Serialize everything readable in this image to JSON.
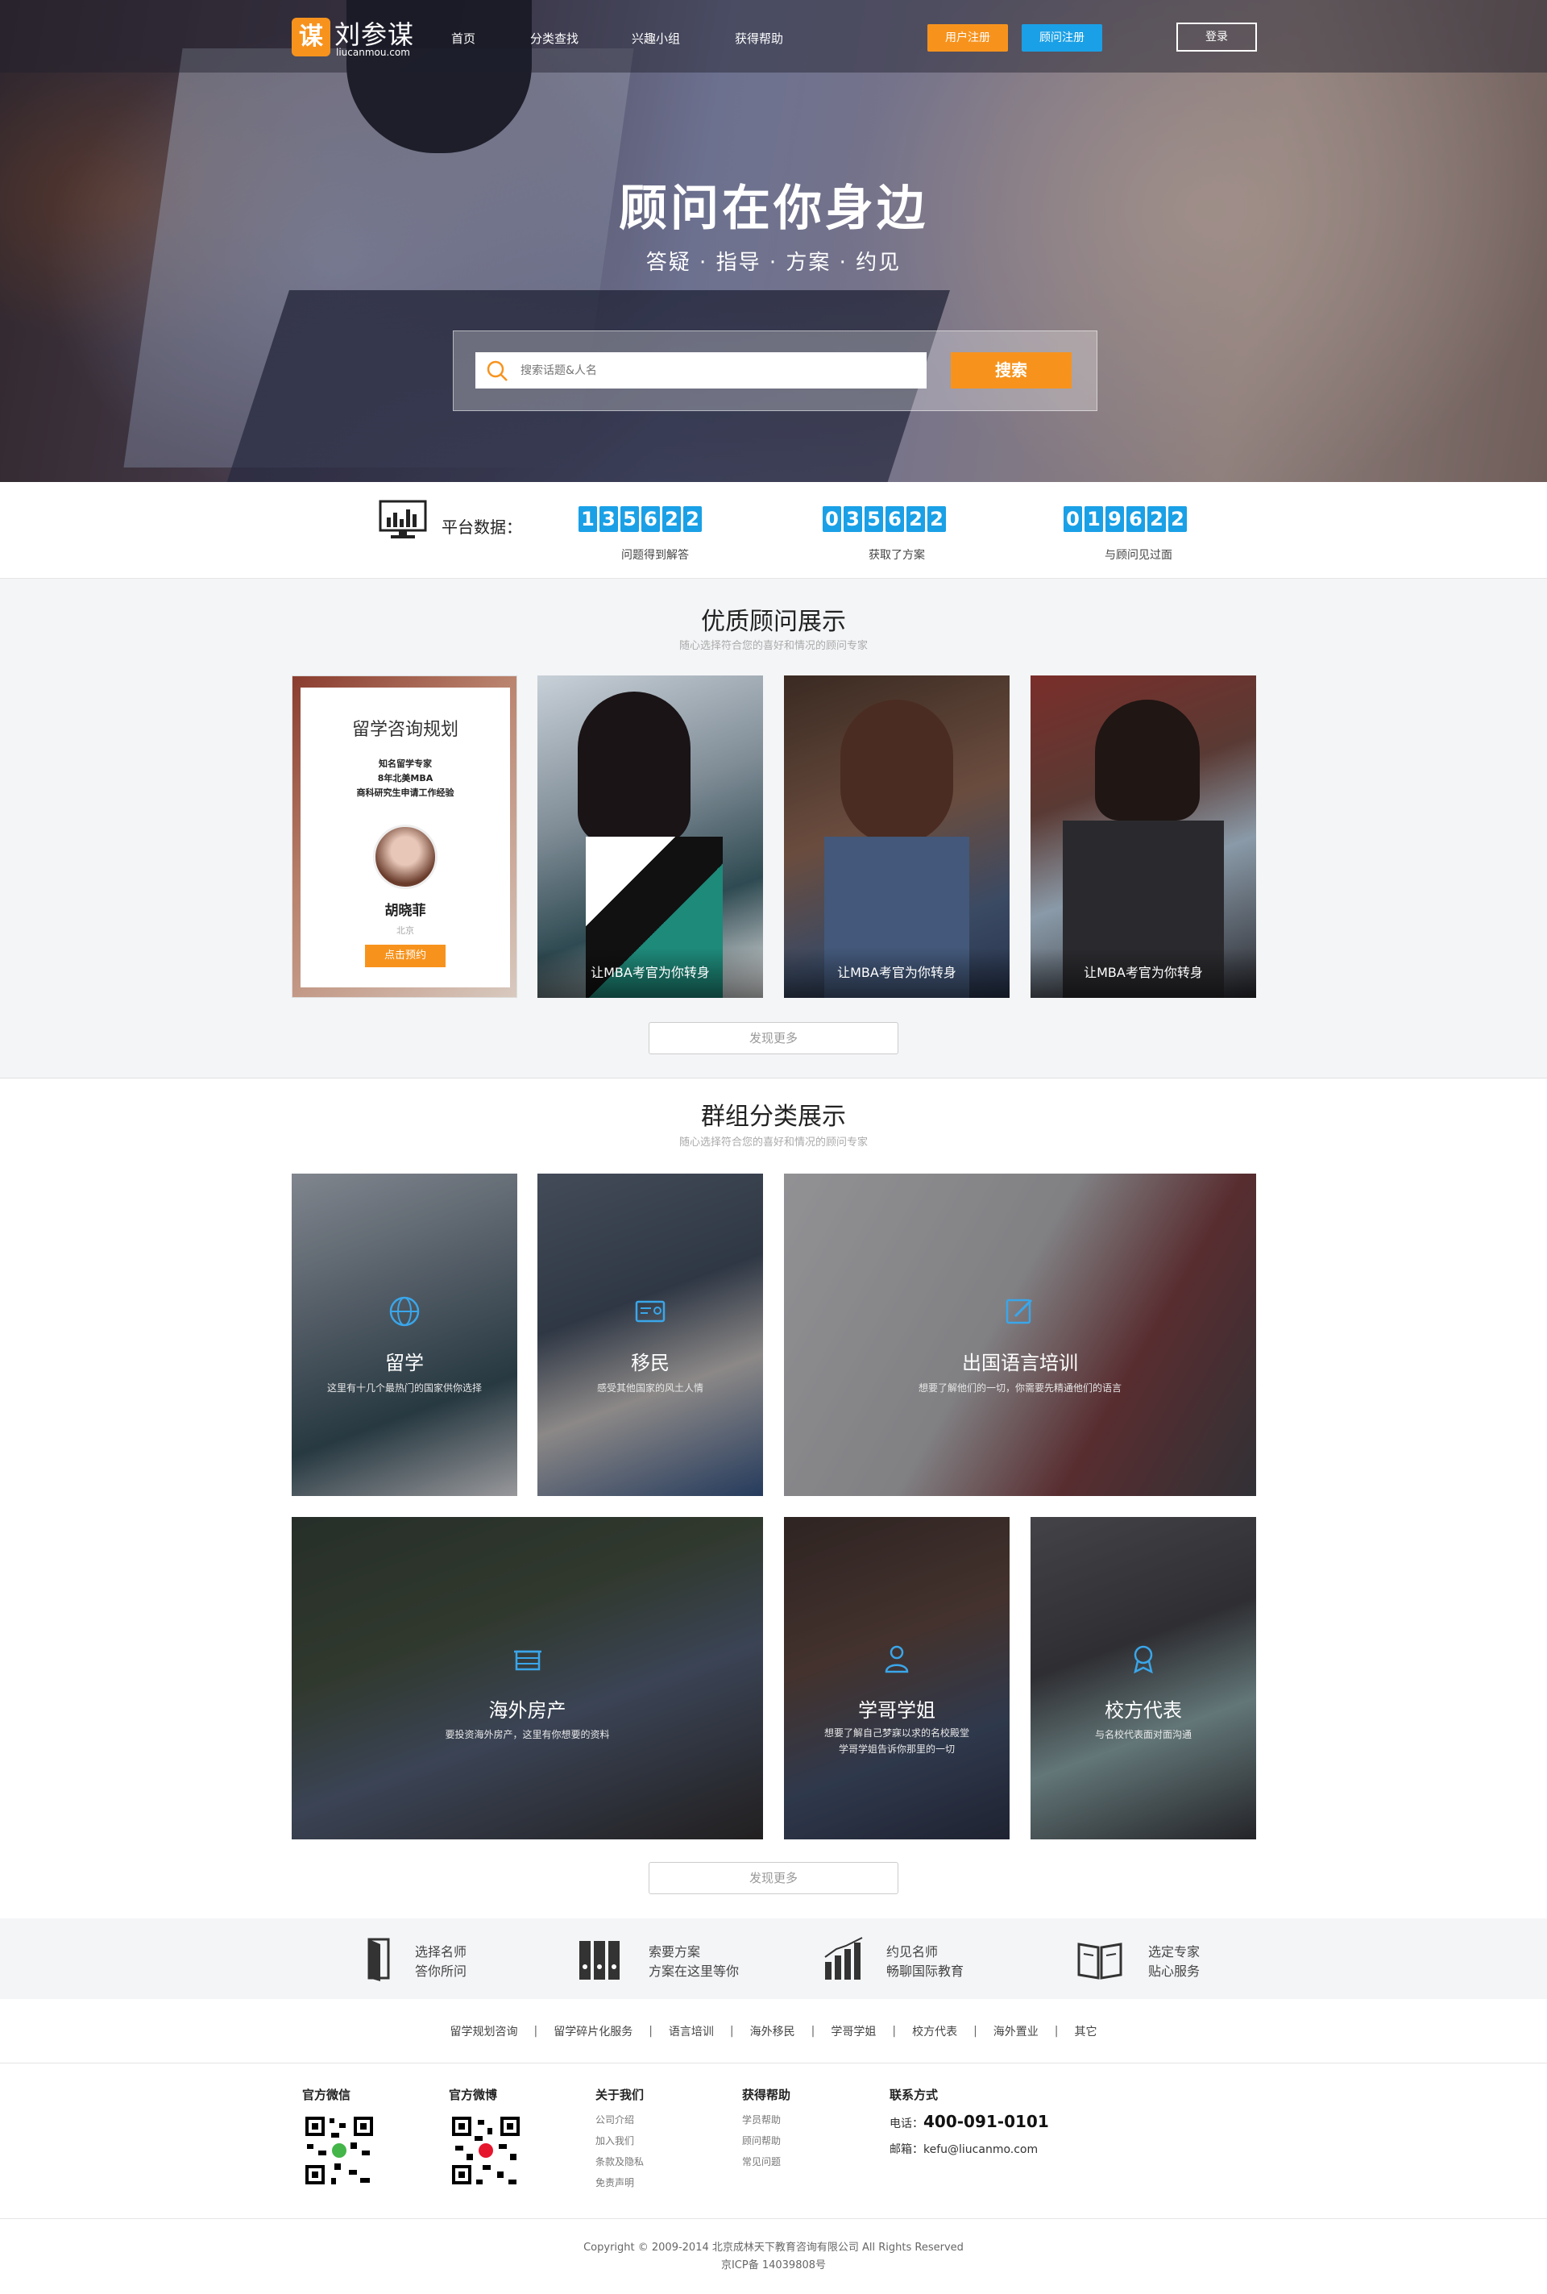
{
  "brand": {
    "logo_char": "谋",
    "name": "刘参谋",
    "url": "liucanmou.com"
  },
  "nav": {
    "items": [
      "首页",
      "分类查找",
      "兴趣小组",
      "获得帮助"
    ],
    "user_register": "用户注册",
    "advisor_register": "顾问注册",
    "login": "登录"
  },
  "hero": {
    "title": "顾问在你身边",
    "subtitle": "答疑 · 指导 · 方案 · 约见",
    "search_placeholder": "搜索话题&人名",
    "search_button": "搜索"
  },
  "stats": {
    "label": "平台数据：",
    "items": [
      {
        "digits": [
          "1",
          "3",
          "5",
          "6",
          "2",
          "2"
        ],
        "caption": "问题得到解答"
      },
      {
        "digits": [
          "0",
          "3",
          "5",
          "6",
          "2",
          "2"
        ],
        "caption": "获取了方案"
      },
      {
        "digits": [
          "0",
          "1",
          "9",
          "6",
          "2",
          "2"
        ],
        "caption": "与顾问见过面"
      }
    ]
  },
  "advisors": {
    "title": "优质顾问展示",
    "subtitle": "随心选择符合您的喜好和情况的顾问专家",
    "info_card": {
      "heading": "留学咨询规划",
      "lines": [
        "知名留学专家",
        "8年北美MBA",
        "商科研究生申请工作经验"
      ],
      "name": "胡晓菲",
      "city": "北京",
      "button": "点击预约"
    },
    "cards": [
      "让MBA考官为你转身",
      "让MBA考官为你转身",
      "让MBA考官为你转身"
    ],
    "more": "发现更多"
  },
  "groups": {
    "title": "群组分类展示",
    "subtitle": "随心选择符合您的喜好和情况的顾问专家",
    "tiles": [
      {
        "title": "留学",
        "desc": "这里有十几个最热门的国家供你选择",
        "icon": "globe-icon"
      },
      {
        "title": "移民",
        "desc": "感受其他国家的风土人情",
        "icon": "id-card-icon"
      },
      {
        "title": "出国语言培训",
        "desc": "想要了解他们的一切，你需要先精通他们的语言",
        "icon": "edit-icon"
      },
      {
        "title": "海外房产",
        "desc": "要投资海外房产，这里有你想要的资料",
        "icon": "house-icon"
      },
      {
        "title": "学哥学姐",
        "desc": "想要了解自己梦寐以求的名校殿堂",
        "desc2": "学哥学姐告诉你那里的一切",
        "icon": "person-icon"
      },
      {
        "title": "校方代表",
        "desc": "与名校代表面对面沟通",
        "icon": "badge-icon"
      }
    ],
    "more": "发现更多"
  },
  "features": [
    {
      "l1": "选择名师",
      "l2": "答你所问",
      "icon": "door-icon"
    },
    {
      "l1": "索要方案",
      "l2": "方案在这里等你",
      "icon": "binders-icon"
    },
    {
      "l1": "约见名师",
      "l2": "畅聊国际教育",
      "icon": "chart-icon"
    },
    {
      "l1": "选定专家",
      "l2": "贴心服务",
      "icon": "book-icon"
    }
  ],
  "links": [
    "留学规划咨询",
    "留学碎片化服务",
    "语言培训",
    "海外移民",
    "学哥学姐",
    "校方代表",
    "海外置业",
    "其它"
  ],
  "footer": {
    "wechat": "官方微信",
    "weibo": "官方微博",
    "about": {
      "title": "关于我们",
      "items": [
        "公司介绍",
        "加入我们",
        "条款及隐私",
        "免责声明"
      ]
    },
    "help": {
      "title": "获得帮助",
      "items": [
        "学员帮助",
        "顾问帮助",
        "常见问题"
      ]
    },
    "contact": {
      "title": "联系方式",
      "phone_label": "电话：",
      "phone": "400-091-0101",
      "email": "邮箱：kefu@liucanmo.com"
    },
    "copyright": "Copyright © 2009-2014 北京成林天下教育咨询有限公司 All Rights Reserved",
    "icp": "京ICP备 14039808号"
  },
  "colors": {
    "accent": "#f7931d",
    "blue": "#1aa0e6"
  }
}
